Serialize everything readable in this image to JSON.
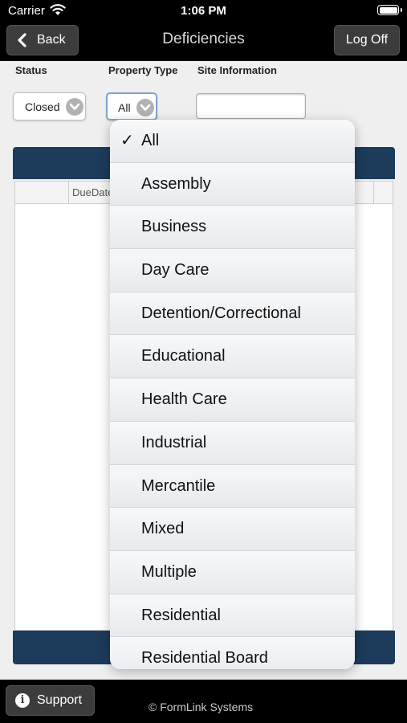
{
  "status_bar": {
    "carrier": "Carrier",
    "time": "1:06 PM"
  },
  "nav": {
    "back_label": "Back",
    "title": "Deficiencies",
    "logoff_label": "Log Off"
  },
  "filters": {
    "status_label": "Status",
    "status_value": "Closed",
    "property_type_label": "Property Type",
    "property_type_value": "All",
    "site_info_label": "Site Information",
    "site_info_value": ""
  },
  "grid": {
    "columns": [
      "",
      "DueDate"
    ]
  },
  "property_type_options": [
    {
      "label": "All",
      "selected": true
    },
    {
      "label": "Assembly",
      "selected": false
    },
    {
      "label": "Business",
      "selected": false
    },
    {
      "label": "Day Care",
      "selected": false
    },
    {
      "label": "Detention/Correctional",
      "selected": false
    },
    {
      "label": "Educational",
      "selected": false
    },
    {
      "label": "Health Care",
      "selected": false
    },
    {
      "label": "Industrial",
      "selected": false
    },
    {
      "label": "Mercantile",
      "selected": false
    },
    {
      "label": "Mixed",
      "selected": false
    },
    {
      "label": "Multiple",
      "selected": false
    },
    {
      "label": "Residential",
      "selected": false
    },
    {
      "label": "Residential Board",
      "selected": false
    }
  ],
  "footer": {
    "support_label": "Support",
    "copyright": "© FormLink Systems"
  },
  "colors": {
    "header_blue": "#1d3b5a",
    "button_gray": "#3c3c3c"
  },
  "icons": {
    "check": "✓",
    "info": "i"
  }
}
